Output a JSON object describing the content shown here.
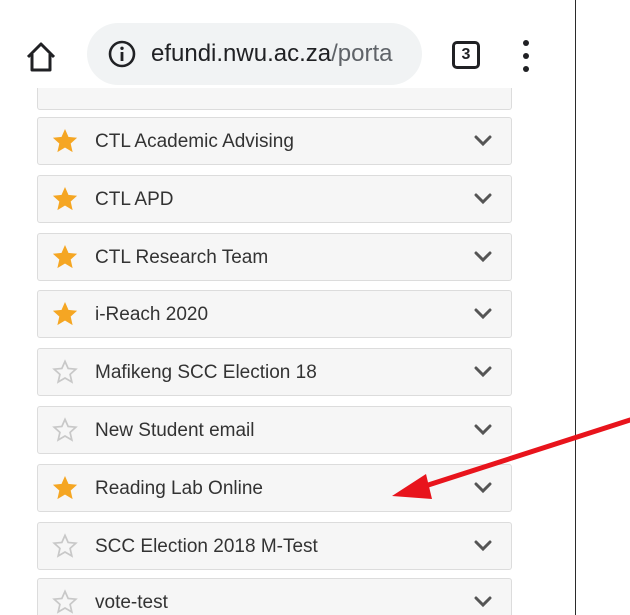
{
  "browser": {
    "url_host": "efundi.nwu.ac.za",
    "url_path": "/porta",
    "tab_count": "3"
  },
  "sites": [
    {
      "label": "CTL Academic Advising",
      "favorite": true
    },
    {
      "label": "CTL APD",
      "favorite": true
    },
    {
      "label": "CTL Research Team",
      "favorite": true
    },
    {
      "label": "i-Reach 2020",
      "favorite": true
    },
    {
      "label": "Mafikeng SCC Election 18",
      "favorite": false
    },
    {
      "label": "New Student email",
      "favorite": false
    },
    {
      "label": "Reading Lab Online",
      "favorite": true
    },
    {
      "label": "SCC Election 2018 M-Test",
      "favorite": false
    },
    {
      "label": "vote-test",
      "favorite": false
    }
  ],
  "colors": {
    "star_filled": "#f5a623",
    "star_outline": "#c8c8c8",
    "chevron": "#555555",
    "arrow": "#e8141c"
  },
  "icons": {
    "home": "home-icon",
    "info": "info-icon",
    "menu": "more-vert-icon",
    "star": "star-icon",
    "chevron": "chevron-down-icon"
  }
}
